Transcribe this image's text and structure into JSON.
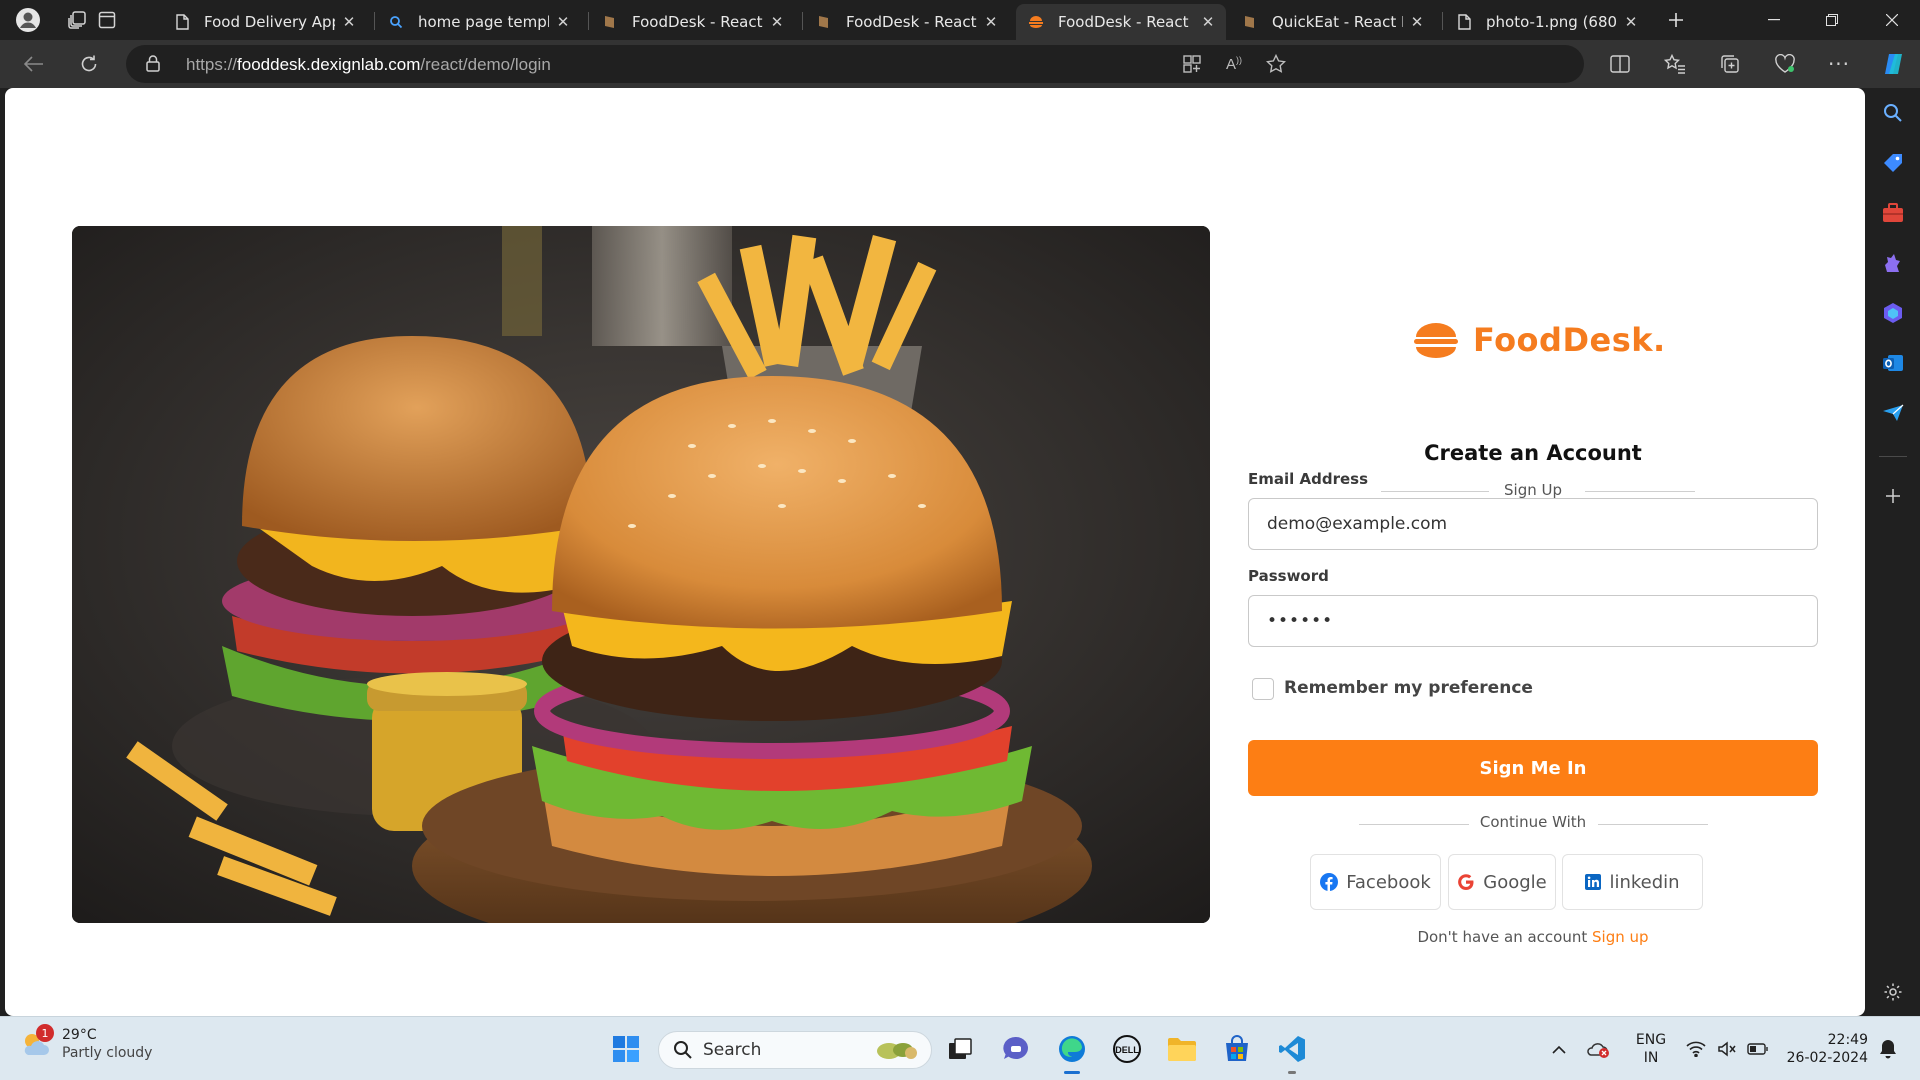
{
  "browser": {
    "tabs": [
      {
        "title": "Food Delivery App",
        "favicon": "page-icon",
        "active": false
      },
      {
        "title": "home page templat",
        "favicon": "search-icon",
        "active": false
      },
      {
        "title": "FoodDesk - React F",
        "favicon": "fooddesk-brown-icon",
        "active": false
      },
      {
        "title": "FoodDesk - React F",
        "favicon": "fooddesk-brown-icon",
        "active": false
      },
      {
        "title": "FoodDesk - React O",
        "favicon": "fooddesk-orange-icon",
        "active": true
      },
      {
        "title": "QuickEat - React Re",
        "favicon": "fooddesk-brown-icon",
        "active": false
      },
      {
        "title": "photo-1.png (680×",
        "favicon": "page-icon",
        "active": false
      }
    ],
    "url_prefix": "https://",
    "url_host": "fooddesk.dexignlab.com",
    "url_path": "/react/demo/login"
  },
  "login": {
    "brand": "FoodDesk.",
    "heading": "Create an Account",
    "subheading": "Sign Up",
    "email_label": "Email Address",
    "email_value": "demo@example.com",
    "password_label": "Password",
    "password_value": "••••••",
    "remember_label": "Remember my preference",
    "submit_label": "Sign Me In",
    "continue_with": "Continue With",
    "social": [
      {
        "label": "Facebook",
        "icon": "facebook-icon"
      },
      {
        "label": "Google",
        "icon": "google-icon"
      },
      {
        "label": "linkedin",
        "icon": "linkedin-icon"
      }
    ],
    "signup_prompt": "Don't have an account",
    "signup_link": "Sign up",
    "accent_color": "#fd7e14"
  },
  "taskbar": {
    "weather_badge": "1",
    "weather_temp": "29°C",
    "weather_desc": "Partly cloudy",
    "search_placeholder": "Search",
    "lang_line1": "ENG",
    "lang_line2": "IN",
    "time": "22:49",
    "date": "26-02-2024"
  }
}
